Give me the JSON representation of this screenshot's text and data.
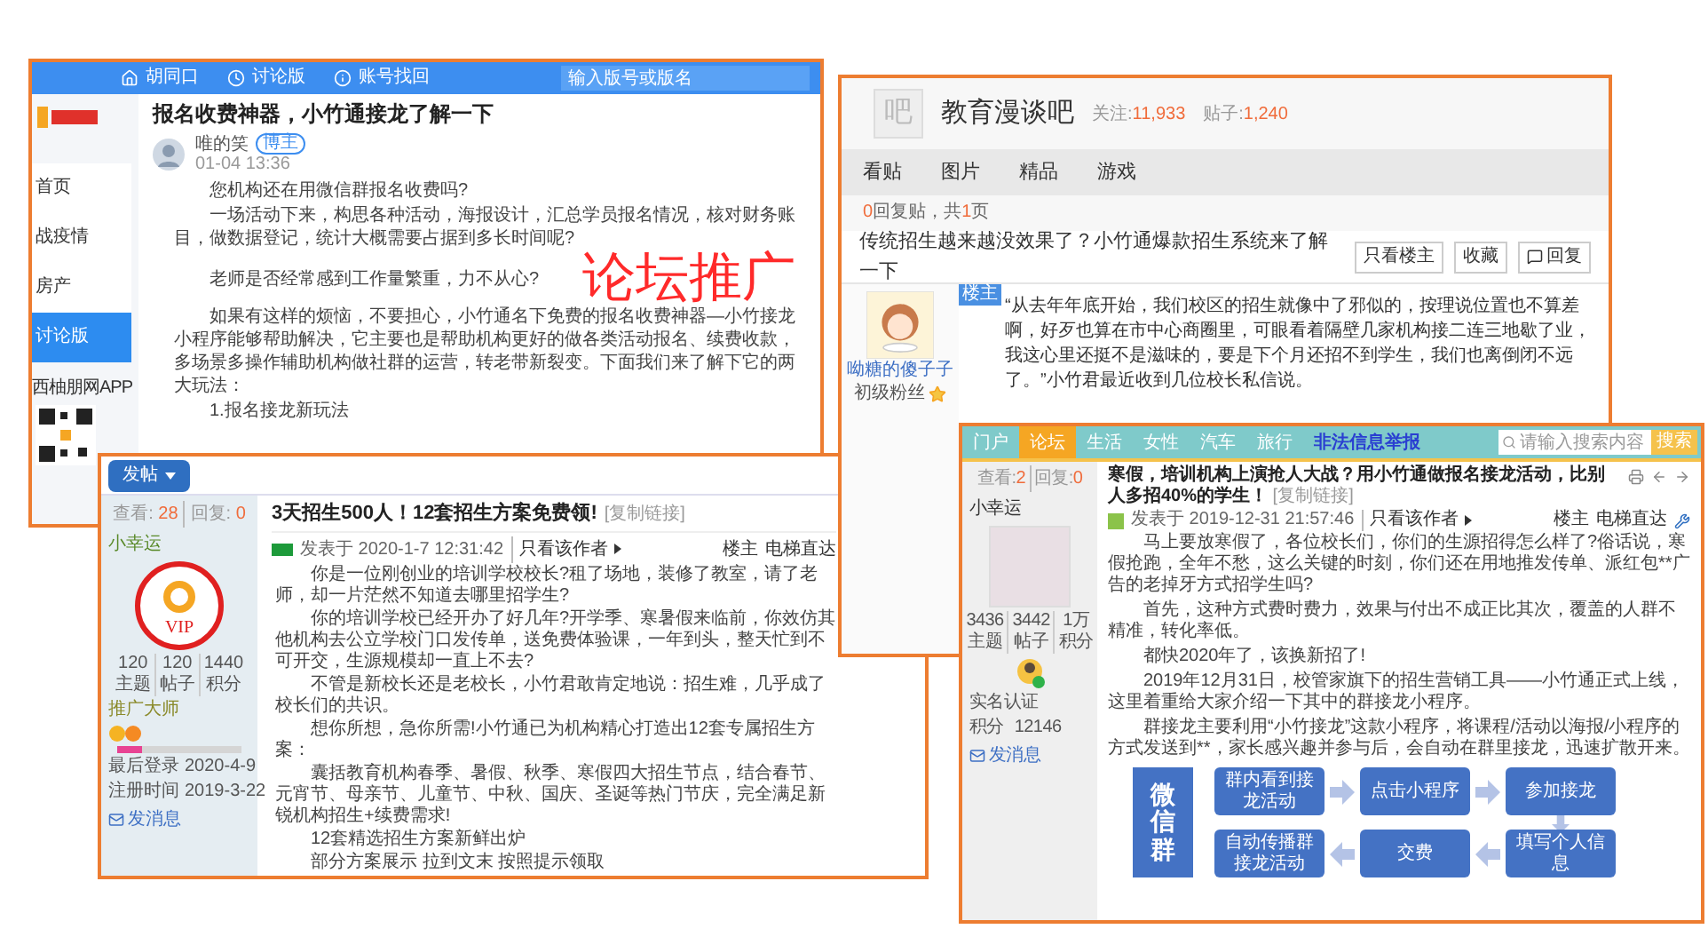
{
  "overlay_caption": "论坛推广",
  "forum_a": {
    "nav": [
      {
        "label": "胡同口",
        "kind": "home"
      },
      {
        "label": "讨论版",
        "kind": "clock"
      },
      {
        "label": "账号找回",
        "kind": "info"
      }
    ],
    "search": {
      "placeholder": "输入版号或版名"
    },
    "sidebar": {
      "items": [
        {
          "label": "首页",
          "selected": false
        },
        {
          "label": "战疫情",
          "selected": false
        },
        {
          "label": "房产",
          "selected": false
        },
        {
          "label": "讨论版",
          "selected": true
        }
      ],
      "app_label": "西柚朋网APP"
    },
    "post": {
      "title": "报名收费神器，小竹通接龙了解一下",
      "author": "唯的笑",
      "badge": "博主",
      "time": "01-04 13:36",
      "paragraphs": [
        "您机构还在用微信群报名收费吗?",
        "一场活动下来，构思各种活动，海报设计，汇总学员报名情况，核对财务账目，做数据登记，统计大概需要占据到多长时间呢?",
        "老师是否经常感到工作量繁重，力不从心?",
        "如果有这样的烦恼，不要担心，小竹通名下免费的报名收费神器—小竹接龙小程序能够帮助解决，它主要也是帮助机构更好的做各类活动报名、续费收款，多场景多操作辅助机构做社群的运营，转老带新裂变。下面我们来了解下它的两大玩法：",
        "1.报名接龙新玩法"
      ]
    }
  },
  "forum_b": {
    "logo_char": "吧",
    "name": "教育漫谈吧",
    "stats": [
      {
        "label": "关注:",
        "value": "11,933"
      },
      {
        "label": "贴子:",
        "value": "1,240"
      }
    ],
    "tabs": [
      {
        "label": "看贴"
      },
      {
        "label": "图片"
      },
      {
        "label": "精品"
      },
      {
        "label": "游戏"
      }
    ],
    "reply_summary": {
      "replies": "0",
      "middle": "回复贴，共",
      "pages": "1",
      "end": "页"
    },
    "post_title": "传统招生越来越没效果了？小竹通爆款招生系统来了解一下",
    "actions": [
      {
        "label": "只看楼主",
        "kind": "plain"
      },
      {
        "label": "收藏",
        "kind": "plain"
      },
      {
        "label": "回复",
        "kind": "reply"
      }
    ],
    "op_badge": "楼主",
    "user": {
      "name": "呦糖的傻子子",
      "level": "初级粉丝"
    },
    "paragraphs": [
      "“从去年年底开始，我们校区的招生就像中了邪似的，按理说位置也不算差啊，好歹也算在市中心商圈里，可眼看着隔壁几家机构接二连三地歇了业，我这心里还挺不是滋味的，要是下个月还招不到学生，我们也离倒闭不远了。”小竹君最近收到几位校长私信说。"
    ]
  },
  "forum_c": {
    "post_button": "发帖",
    "views_label": "查看:",
    "views": "28",
    "replies_label": "回复:",
    "replies": "0",
    "title": "3天招生500人！12套招生方案免费领!",
    "copy_link": "[复制链接]",
    "user": "小幸运",
    "stamp": "VIP",
    "meta": "发表于 2020-1-7 12:31:42",
    "only_author": "只看该作者",
    "floor": "楼主",
    "jump": "电梯直达",
    "profile_stats": [
      {
        "value": "120",
        "label": "主题"
      },
      {
        "value": "120",
        "label": "帖子"
      },
      {
        "value": "1440",
        "label": "积分"
      }
    ],
    "rank": "推广大师",
    "progress": {
      "level": 0.2
    },
    "info": [
      {
        "label": "最后登录",
        "value": "2020-4-9"
      },
      {
        "label": "注册时间",
        "value": "2019-3-22"
      }
    ],
    "message": "发消息",
    "paragraphs": [
      "你是一位刚创业的培训学校校长?租了场地，装修了教室，请了老师，却一片茫然不知道去哪里招学生?",
      "你的培训学校已经开办了好几年?开学季、寒暑假来临前，你效仿其他机构去公立学校门口发传单，送免费体验课，一年到头，整天忙到不可开交，生源规模却一直上不去?",
      "不管是新校长还是老校长，小竹君敢肯定地说：招生难，几乎成了校长们的共识。",
      "想你所想，急你所需!小竹通已为机构精心打造出12套专属招生方案：",
      "囊括教育机构春季、暑假、秋季、寒假四大招生节点，结合春节、元宵节、母亲节、儿童节、中秋、国庆、圣诞等热门节庆，完全满足新锐机构招生+续费需求!",
      "12套精选招生方案新鲜出炉",
      "部分方案展示 拉到文末 按照提示领取"
    ]
  },
  "forum_d": {
    "nav": [
      {
        "label": "门户",
        "kind": "tab",
        "selected": false
      },
      {
        "label": "论坛",
        "kind": "tab",
        "selected": true
      },
      {
        "label": "生活",
        "kind": "tab",
        "selected": false
      },
      {
        "label": "女性",
        "kind": "tab",
        "selected": false
      },
      {
        "label": "汽车",
        "kind": "tab",
        "selected": false
      },
      {
        "label": "旅行",
        "kind": "tab",
        "selected": false
      },
      {
        "label": "非法信息举报",
        "kind": "report",
        "selected": false
      }
    ],
    "search": {
      "placeholder": "请输入搜索内容",
      "button": "搜索"
    },
    "views_label": "查看:",
    "views": "2",
    "replies_label": "回复:",
    "replies": "0",
    "title": "寒假，培训机构上演抢人大战？用小竹通做报名接龙活动，比别人多招40%的学生！",
    "copy_link": "[复制链接]",
    "user": "小幸运",
    "meta": "发表于 2019-12-31 21:57:46",
    "only_author": "只看该作者",
    "floor": "楼主",
    "jump": "电梯直达",
    "profile_stats": [
      {
        "value": "3436",
        "label": "主题"
      },
      {
        "value": "3442",
        "label": "帖子"
      },
      {
        "value": "1万",
        "label": "积分"
      }
    ],
    "verified": "实名认证",
    "points": {
      "label": "积分",
      "value": "12146"
    },
    "message": "发消息",
    "paragraphs": [
      "马上要放寒假了，各位校长们，你们的生源招得怎么样了?俗话说，寒假抢跑，全年不愁，这么关键的时刻，你们还在用地推发传单、派红包**广告的老掉牙方式招学生吗?",
      "首先，这种方式费时费力，效果与付出不成正比其次，覆盖的人群不精准，转化率低。",
      "都快2020年了，该换新招了!",
      "2019年12月31日，校管家旗下的招生营销工具——小竹通正式上线，这里着重给大家介绍一下其中的群接龙小程序。",
      "群接龙主要利用“小竹接龙”这款小程序，将课程/活动以海报/小程序的方式发送到**，家长感兴趣并参与后，会自动在群里接龙，迅速扩散开来。"
    ],
    "flow": {
      "group": "微信群",
      "steps": [
        "群内看到接龙活动",
        "点击小程序",
        "参加接龙",
        "自动传播群接龙活动",
        "交费",
        "填写个人信息"
      ]
    }
  }
}
